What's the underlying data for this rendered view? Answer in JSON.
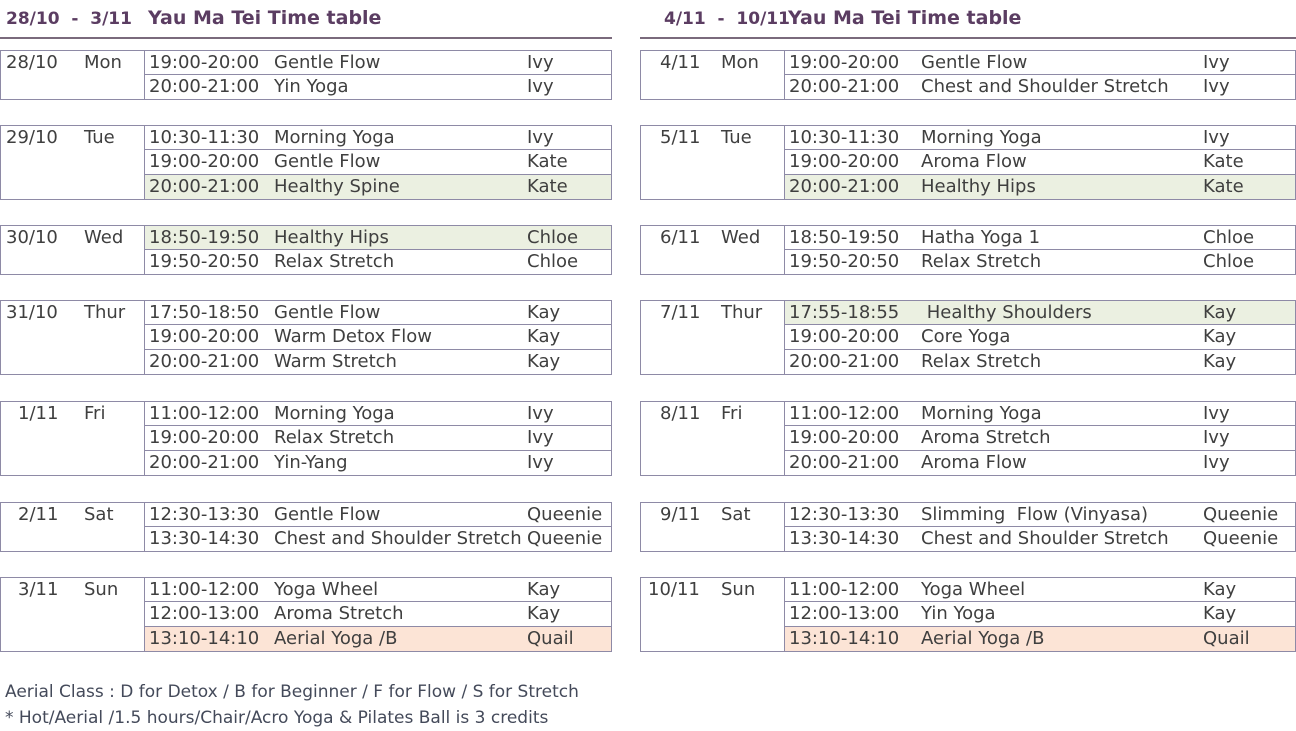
{
  "colors": {
    "header_text": "#5b3d62",
    "highlight_green": "#ebf0e1",
    "highlight_orange": "#fce4d6",
    "grid": "#8e8aa6"
  },
  "panels": [
    {
      "range": "28/10  -  3/11",
      "title": "Yau Ma Tei Time table",
      "days": [
        {
          "date": "28/10",
          "weekday": "Mon",
          "classes": [
            {
              "time": "19:00-20:00",
              "name": "Gentle Flow",
              "teacher": "Ivy",
              "hl": ""
            },
            {
              "time": "20:00-21:00",
              "name": "Yin Yoga",
              "teacher": "Ivy",
              "hl": ""
            }
          ]
        },
        {
          "date": "29/10",
          "weekday": "Tue",
          "classes": [
            {
              "time": "10:30-11:30",
              "name": "Morning Yoga",
              "teacher": "Ivy",
              "hl": ""
            },
            {
              "time": "19:00-20:00",
              "name": "Gentle Flow",
              "teacher": "Kate",
              "hl": ""
            },
            {
              "time": "20:00-21:00",
              "name": "Healthy Spine",
              "teacher": "Kate",
              "hl": "g"
            }
          ]
        },
        {
          "date": "30/10",
          "weekday": "Wed",
          "classes": [
            {
              "time": "18:50-19:50",
              "name": "Healthy Hips",
              "teacher": "Chloe",
              "hl": "g"
            },
            {
              "time": "19:50-20:50",
              "name": "Relax Stretch",
              "teacher": "Chloe",
              "hl": ""
            }
          ]
        },
        {
          "date": "31/10",
          "weekday": "Thur",
          "classes": [
            {
              "time": "17:50-18:50",
              "name": "Gentle Flow",
              "teacher": "Kay",
              "hl": ""
            },
            {
              "time": "19:00-20:00",
              "name": "Warm Detox Flow",
              "teacher": "Kay",
              "hl": ""
            },
            {
              "time": "20:00-21:00",
              "name": "Warm Stretch",
              "teacher": "Kay",
              "hl": ""
            }
          ]
        },
        {
          "date": "1/11",
          "weekday": "Fri",
          "classes": [
            {
              "time": "11:00-12:00",
              "name": "Morning Yoga",
              "teacher": "Ivy",
              "hl": ""
            },
            {
              "time": "19:00-20:00",
              "name": "Relax Stretch",
              "teacher": "Ivy",
              "hl": ""
            },
            {
              "time": "20:00-21:00",
              "name": "Yin-Yang",
              "teacher": "Ivy",
              "hl": ""
            }
          ]
        },
        {
          "date": "2/11",
          "weekday": "Sat",
          "classes": [
            {
              "time": "12:30-13:30",
              "name": "Gentle Flow",
              "teacher": "Queenie",
              "hl": ""
            },
            {
              "time": "13:30-14:30",
              "name": "Chest and Shoulder Stretch",
              "teacher": "Queenie",
              "hl": ""
            }
          ]
        },
        {
          "date": "3/11",
          "weekday": "Sun",
          "classes": [
            {
              "time": "11:00-12:00",
              "name": "Yoga Wheel",
              "teacher": "Kay",
              "hl": ""
            },
            {
              "time": "12:00-13:00",
              "name": "Aroma Stretch",
              "teacher": "Kay",
              "hl": ""
            },
            {
              "time": "13:10-14:10",
              "name": "Aerial Yoga /B",
              "teacher": "Quail",
              "hl": "o"
            }
          ]
        }
      ]
    },
    {
      "range": "4/11  -  10/11",
      "title": "Yau Ma Tei Time table",
      "days": [
        {
          "date": "4/11",
          "weekday": "Mon",
          "classes": [
            {
              "time": "19:00-20:00",
              "name": "Gentle Flow",
              "teacher": "Ivy",
              "hl": ""
            },
            {
              "time": "20:00-21:00",
              "name": "Chest and Shoulder Stretch",
              "teacher": "Ivy",
              "hl": ""
            }
          ]
        },
        {
          "date": "5/11",
          "weekday": "Tue",
          "classes": [
            {
              "time": "10:30-11:30",
              "name": "Morning Yoga",
              "teacher": "Ivy",
              "hl": ""
            },
            {
              "time": "19:00-20:00",
              "name": "Aroma Flow",
              "teacher": "Kate",
              "hl": ""
            },
            {
              "time": "20:00-21:00",
              "name": "Healthy Hips",
              "teacher": "Kate",
              "hl": "g"
            }
          ]
        },
        {
          "date": "6/11",
          "weekday": "Wed",
          "classes": [
            {
              "time": "18:50-19:50",
              "name": "Hatha Yoga 1",
              "teacher": "Chloe",
              "hl": ""
            },
            {
              "time": "19:50-20:50",
              "name": "Relax Stretch",
              "teacher": "Chloe",
              "hl": ""
            }
          ]
        },
        {
          "date": "7/11",
          "weekday": "Thur",
          "classes": [
            {
              "time": "17:55-18:55",
              "name": " Healthy Shoulders",
              "teacher": "Kay",
              "hl": "g"
            },
            {
              "time": "19:00-20:00",
              "name": "Core Yoga",
              "teacher": "Kay",
              "hl": ""
            },
            {
              "time": "20:00-21:00",
              "name": "Relax Stretch",
              "teacher": "Kay",
              "hl": ""
            }
          ]
        },
        {
          "date": "8/11",
          "weekday": "Fri",
          "classes": [
            {
              "time": "11:00-12:00",
              "name": "Morning Yoga",
              "teacher": "Ivy",
              "hl": ""
            },
            {
              "time": "19:00-20:00",
              "name": "Aroma Stretch",
              "teacher": "Ivy",
              "hl": ""
            },
            {
              "time": "20:00-21:00",
              "name": "Aroma Flow",
              "teacher": "Ivy",
              "hl": ""
            }
          ]
        },
        {
          "date": "9/11",
          "weekday": "Sat",
          "classes": [
            {
              "time": "12:30-13:30",
              "name": "Slimming  Flow (Vinyasa)",
              "teacher": "Queenie",
              "hl": ""
            },
            {
              "time": "13:30-14:30",
              "name": "Chest and Shoulder Stretch",
              "teacher": "Queenie",
              "hl": ""
            }
          ]
        },
        {
          "date": "10/11",
          "weekday": "Sun",
          "classes": [
            {
              "time": "11:00-12:00",
              "name": "Yoga Wheel",
              "teacher": "Kay",
              "hl": ""
            },
            {
              "time": "12:00-13:00",
              "name": "Yin Yoga",
              "teacher": "Kay",
              "hl": ""
            },
            {
              "time": "13:10-14:10",
              "name": "Aerial Yoga /B",
              "teacher": "Quail",
              "hl": "o"
            }
          ]
        }
      ]
    }
  ],
  "notes": [
    "Aerial Class : D for Detox / B for Beginner  / F for Flow / S for Stretch",
    "* Hot/Aerial /1.5 hours/Chair/Acro Yoga & Pilates Ball is 3 credits"
  ]
}
